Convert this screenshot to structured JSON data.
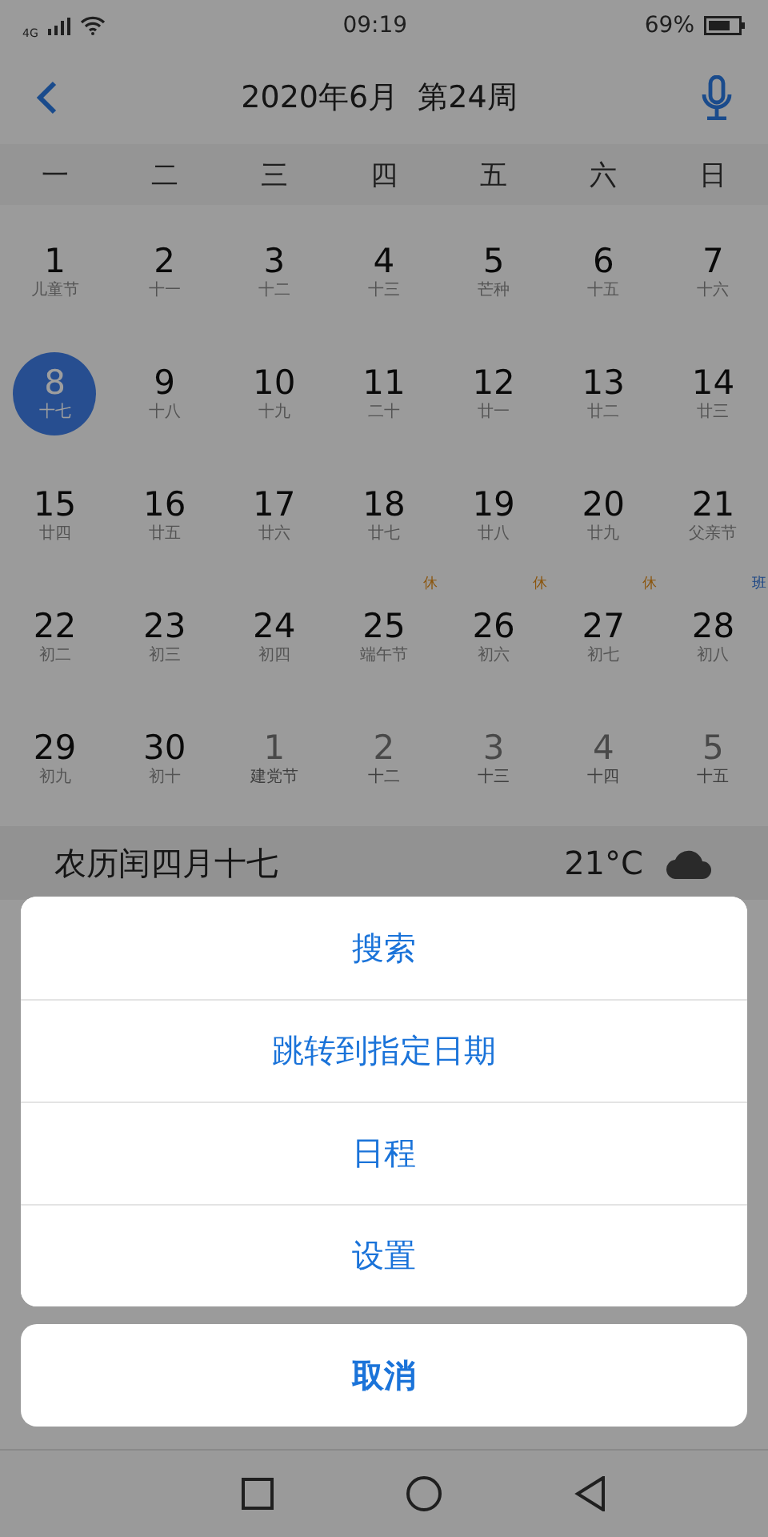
{
  "status_bar": {
    "network": "4G",
    "time": "09:19",
    "battery": "69%"
  },
  "header": {
    "title": "2020年6月  第24周"
  },
  "weekdays": [
    "一",
    "二",
    "三",
    "四",
    "五",
    "六",
    "日"
  ],
  "days": [
    {
      "day": "1",
      "lunar": "儿童节",
      "in_month": true,
      "selected": false
    },
    {
      "day": "2",
      "lunar": "十一",
      "in_month": true,
      "selected": false
    },
    {
      "day": "3",
      "lunar": "十二",
      "in_month": true,
      "selected": false
    },
    {
      "day": "4",
      "lunar": "十三",
      "in_month": true,
      "selected": false
    },
    {
      "day": "5",
      "lunar": "芒种",
      "in_month": true,
      "selected": false
    },
    {
      "day": "6",
      "lunar": "十五",
      "in_month": true,
      "selected": false
    },
    {
      "day": "7",
      "lunar": "十六",
      "in_month": true,
      "selected": false
    },
    {
      "day": "8",
      "lunar": "十七",
      "in_month": true,
      "selected": true
    },
    {
      "day": "9",
      "lunar": "十八",
      "in_month": true,
      "selected": false
    },
    {
      "day": "10",
      "lunar": "十九",
      "in_month": true,
      "selected": false
    },
    {
      "day": "11",
      "lunar": "二十",
      "in_month": true,
      "selected": false
    },
    {
      "day": "12",
      "lunar": "廿一",
      "in_month": true,
      "selected": false
    },
    {
      "day": "13",
      "lunar": "廿二",
      "in_month": true,
      "selected": false
    },
    {
      "day": "14",
      "lunar": "廿三",
      "in_month": true,
      "selected": false
    },
    {
      "day": "15",
      "lunar": "廿四",
      "in_month": true,
      "selected": false
    },
    {
      "day": "16",
      "lunar": "廿五",
      "in_month": true,
      "selected": false
    },
    {
      "day": "17",
      "lunar": "廿六",
      "in_month": true,
      "selected": false
    },
    {
      "day": "18",
      "lunar": "廿七",
      "in_month": true,
      "selected": false
    },
    {
      "day": "19",
      "lunar": "廿八",
      "in_month": true,
      "selected": false
    },
    {
      "day": "20",
      "lunar": "廿九",
      "in_month": true,
      "selected": false
    },
    {
      "day": "21",
      "lunar": "父亲节",
      "in_month": true,
      "selected": false
    },
    {
      "day": "22",
      "lunar": "初二",
      "in_month": true,
      "selected": false
    },
    {
      "day": "23",
      "lunar": "初三",
      "in_month": true,
      "selected": false
    },
    {
      "day": "24",
      "lunar": "初四",
      "in_month": true,
      "selected": false
    },
    {
      "day": "25",
      "lunar": "端午节",
      "in_month": true,
      "selected": false,
      "badge": {
        "kind": "rest",
        "text": "休"
      }
    },
    {
      "day": "26",
      "lunar": "初六",
      "in_month": true,
      "selected": false,
      "badge": {
        "kind": "rest",
        "text": "休"
      }
    },
    {
      "day": "27",
      "lunar": "初七",
      "in_month": true,
      "selected": false,
      "badge": {
        "kind": "rest",
        "text": "休"
      }
    },
    {
      "day": "28",
      "lunar": "初八",
      "in_month": true,
      "selected": false,
      "badge": {
        "kind": "work",
        "text": "班"
      }
    },
    {
      "day": "29",
      "lunar": "初九",
      "in_month": true,
      "selected": false
    },
    {
      "day": "30",
      "lunar": "初十",
      "in_month": true,
      "selected": false
    },
    {
      "day": "1",
      "lunar": "建党节",
      "in_month": false,
      "selected": false
    },
    {
      "day": "2",
      "lunar": "十二",
      "in_month": false,
      "selected": false
    },
    {
      "day": "3",
      "lunar": "十三",
      "in_month": false,
      "selected": false
    },
    {
      "day": "4",
      "lunar": "十四",
      "in_month": false,
      "selected": false
    },
    {
      "day": "5",
      "lunar": "十五",
      "in_month": false,
      "selected": false
    }
  ],
  "info_bar": {
    "lunar_date": "农历闰四月十七",
    "temperature": "21°C"
  },
  "action_sheet": {
    "options": [
      "搜索",
      "跳转到指定日期",
      "日程",
      "设置"
    ],
    "cancel": "取消"
  }
}
